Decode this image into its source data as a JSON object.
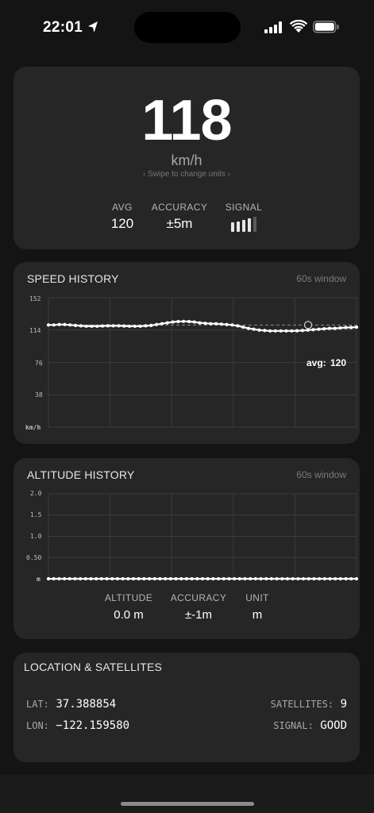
{
  "status_bar": {
    "time": "22:01"
  },
  "speed": {
    "value": "118",
    "unit": "km/h",
    "swipe_hint": "‹  Swipe to change units  ›",
    "stats": {
      "avg_label": "AVG",
      "avg_value": "120",
      "accuracy_label": "ACCURACY",
      "accuracy_value": "±5m",
      "signal_label": "SIGNAL",
      "signal_level_bars": 4,
      "signal_total_bars": 5
    }
  },
  "speed_history": {
    "title": "SPEED HISTORY",
    "window": "60s window",
    "y_ticks": [
      "152",
      "114",
      "76",
      "38"
    ],
    "y_unit": "km/h",
    "avg_label": "avg:",
    "avg_value": "120",
    "chart_data": {
      "type": "line",
      "ylim": [
        0,
        152
      ],
      "avg": 120,
      "values": [
        120,
        120,
        120.5,
        120.5,
        120,
        119.5,
        119,
        118.5,
        118.5,
        118.5,
        118.8,
        119,
        119,
        119,
        118.8,
        118.5,
        118.5,
        118.5,
        119,
        119.5,
        120.5,
        121.5,
        122.5,
        123.5,
        124,
        124.2,
        124,
        123.5,
        122.5,
        122,
        121.5,
        121.5,
        121,
        120.5,
        120,
        119,
        117.5,
        116,
        115,
        114,
        113.5,
        113,
        113,
        113,
        113,
        113,
        113.2,
        113.5,
        114,
        114.5,
        115,
        115.5,
        116,
        116,
        116.5,
        117,
        117,
        117.5
      ]
    }
  },
  "altitude_history": {
    "title": "ALTITUDE HISTORY",
    "window": "60s window",
    "y_ticks": [
      "2.0",
      "1.5",
      "1.0",
      "0.50"
    ],
    "y_unit": "m",
    "chart_data": {
      "type": "line",
      "ylim": [
        0,
        2.0
      ],
      "values": [
        0,
        0,
        0,
        0,
        0,
        0,
        0,
        0,
        0,
        0,
        0,
        0,
        0,
        0,
        0,
        0,
        0,
        0,
        0,
        0,
        0,
        0,
        0,
        0,
        0,
        0,
        0,
        0,
        0,
        0,
        0,
        0,
        0,
        0,
        0,
        0,
        0,
        0,
        0,
        0,
        0,
        0,
        0,
        0,
        0,
        0,
        0,
        0,
        0,
        0,
        0,
        0,
        0,
        0,
        0,
        0,
        0,
        0,
        0
      ]
    },
    "stats": {
      "altitude_label": "ALTITUDE",
      "altitude_value": "0.0 m",
      "accuracy_label": "ACCURACY",
      "accuracy_value": "±-1m",
      "unit_label": "UNIT",
      "unit_value": "m"
    }
  },
  "location": {
    "title": "LOCATION & SATELLITES",
    "lat_label": "LAT:",
    "lat_value": "37.388854",
    "lon_label": "LON:",
    "lon_value": "−122.159580",
    "satellites_label": "SATELLITES:",
    "satellites_value": "9",
    "signal_label": "SIGNAL:",
    "signal_value": "GOOD"
  },
  "colors": {
    "background": "#141414",
    "card": "#262626",
    "line": "#ffffff",
    "grid": "#3c3c3c"
  }
}
